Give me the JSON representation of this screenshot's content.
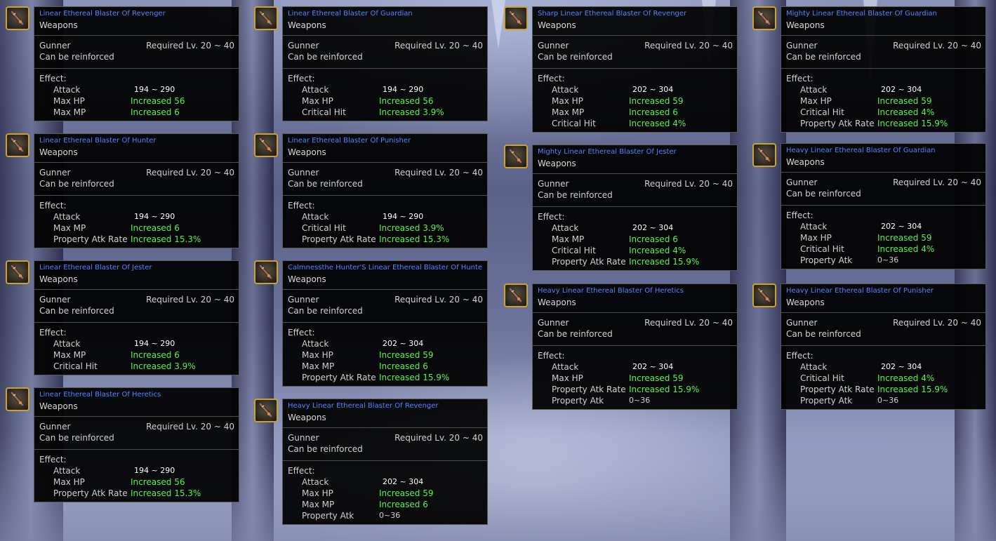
{
  "labels": {
    "category": "Weapons",
    "job": "Gunner",
    "required": "Required Lv. 20 ~ 40",
    "reinforce": "Can be reinforced",
    "effect": "Effect:"
  },
  "colors": {
    "item_name": "#4f86ff",
    "increase": "#59f24d",
    "frame_gold": "#c9a233"
  },
  "icon": "blaster-weapon-icon",
  "columns": [
    [
      {
        "name": "Linear Ethereal Blaster Of Revenger",
        "stats": [
          {
            "label": "Attack",
            "value": "194 ~ 290"
          },
          {
            "label": "Max HP",
            "value": "Increased 56"
          },
          {
            "label": "Max MP",
            "value": "Increased 6"
          }
        ]
      },
      {
        "name": "Linear Ethereal Blaster Of Hunter",
        "stats": [
          {
            "label": "Attack",
            "value": "194 ~ 290"
          },
          {
            "label": "Max MP",
            "value": "Increased 6"
          },
          {
            "label": "Property Atk Rate",
            "value": "Increased 15.3%"
          }
        ]
      },
      {
        "name": "Linear Ethereal Blaster Of Jester",
        "stats": [
          {
            "label": "Attack",
            "value": "194 ~ 290"
          },
          {
            "label": "Max MP",
            "value": "Increased 6"
          },
          {
            "label": "Critical Hit",
            "value": "Increased 3.9%"
          }
        ]
      },
      {
        "name": "Linear Ethereal Blaster Of Heretics",
        "stats": [
          {
            "label": "Attack",
            "value": "194 ~ 290"
          },
          {
            "label": "Max HP",
            "value": "Increased 56"
          },
          {
            "label": "Property Atk Rate",
            "value": "Increased 15.3%"
          }
        ]
      }
    ],
    [
      {
        "name": "Linear Ethereal Blaster Of Guardian",
        "stats": [
          {
            "label": "Attack",
            "value": "194 ~ 290"
          },
          {
            "label": "Max HP",
            "value": "Increased 56"
          },
          {
            "label": "Critical Hit",
            "value": "Increased 3.9%"
          }
        ]
      },
      {
        "name": "Linear Ethereal Blaster Of Punisher",
        "stats": [
          {
            "label": "Attack",
            "value": "194 ~ 290"
          },
          {
            "label": "Critical Hit",
            "value": "Increased 3.9%"
          },
          {
            "label": "Property Atk Rate",
            "value": "Increased 15.3%"
          }
        ]
      },
      {
        "name": "Calmnessthe Hunter'S Linear Ethereal Blaster Of Hunter",
        "stats": [
          {
            "label": "Attack",
            "value": "202 ~ 304"
          },
          {
            "label": "Max HP",
            "value": "Increased 59"
          },
          {
            "label": "Max MP",
            "value": "Increased 6"
          },
          {
            "label": "Property Atk Rate",
            "value": "Increased 15.9%"
          }
        ]
      },
      {
        "name": "Heavy Linear Ethereal Blaster Of Revenger",
        "stats": [
          {
            "label": "Attack",
            "value": "202 ~ 304"
          },
          {
            "label": "Max HP",
            "value": "Increased 59"
          },
          {
            "label": "Max MP",
            "value": "Increased 6"
          },
          {
            "label": "Property Atk",
            "value": "0~36"
          }
        ]
      }
    ],
    [
      {
        "name": "Sharp Linear Ethereal Blaster Of Revenger",
        "stats": [
          {
            "label": "Attack",
            "value": "202 ~ 304"
          },
          {
            "label": "Max HP",
            "value": "Increased 59"
          },
          {
            "label": "Max MP",
            "value": "Increased 6"
          },
          {
            "label": "Critical Hit",
            "value": "Increased 4%"
          }
        ]
      },
      {
        "name": "Mighty Linear Ethereal Blaster Of Jester",
        "stats": [
          {
            "label": "Attack",
            "value": "202 ~ 304"
          },
          {
            "label": "Max MP",
            "value": "Increased 6"
          },
          {
            "label": "Critical Hit",
            "value": "Increased 4%"
          },
          {
            "label": "Property Atk Rate",
            "value": "Increased 15.9%"
          }
        ]
      },
      {
        "name": "Heavy Linear Ethereal Blaster Of Heretics",
        "stats": [
          {
            "label": "Attack",
            "value": "202 ~ 304"
          },
          {
            "label": "Max HP",
            "value": "Increased 59"
          },
          {
            "label": "Property Atk Rate",
            "value": "Increased 15.9%"
          },
          {
            "label": "Property Atk",
            "value": "0~36"
          }
        ]
      }
    ],
    [
      {
        "name": "Mighty Linear Ethereal Blaster Of Guardian",
        "stats": [
          {
            "label": "Attack",
            "value": "202 ~ 304"
          },
          {
            "label": "Max HP",
            "value": "Increased 59"
          },
          {
            "label": "Critical Hit",
            "value": "Increased 4%"
          },
          {
            "label": "Property Atk Rate",
            "value": "Increased 15.9%"
          }
        ]
      },
      {
        "name": "Heavy Linear Ethereal Blaster Of Guardian",
        "stats": [
          {
            "label": "Attack",
            "value": "202 ~ 304"
          },
          {
            "label": "Max HP",
            "value": "Increased 59"
          },
          {
            "label": "Critical Hit",
            "value": "Increased 4%"
          },
          {
            "label": "Property Atk",
            "value": "0~36"
          }
        ]
      },
      {
        "name": "Heavy Linear Ethereal Blaster Of Punisher",
        "stats": [
          {
            "label": "Attack",
            "value": "202 ~ 304"
          },
          {
            "label": "Critical Hit",
            "value": "Increased 4%"
          },
          {
            "label": "Property Atk Rate",
            "value": "Increased 15.9%"
          },
          {
            "label": "Property Atk",
            "value": "0~36"
          }
        ]
      }
    ]
  ]
}
